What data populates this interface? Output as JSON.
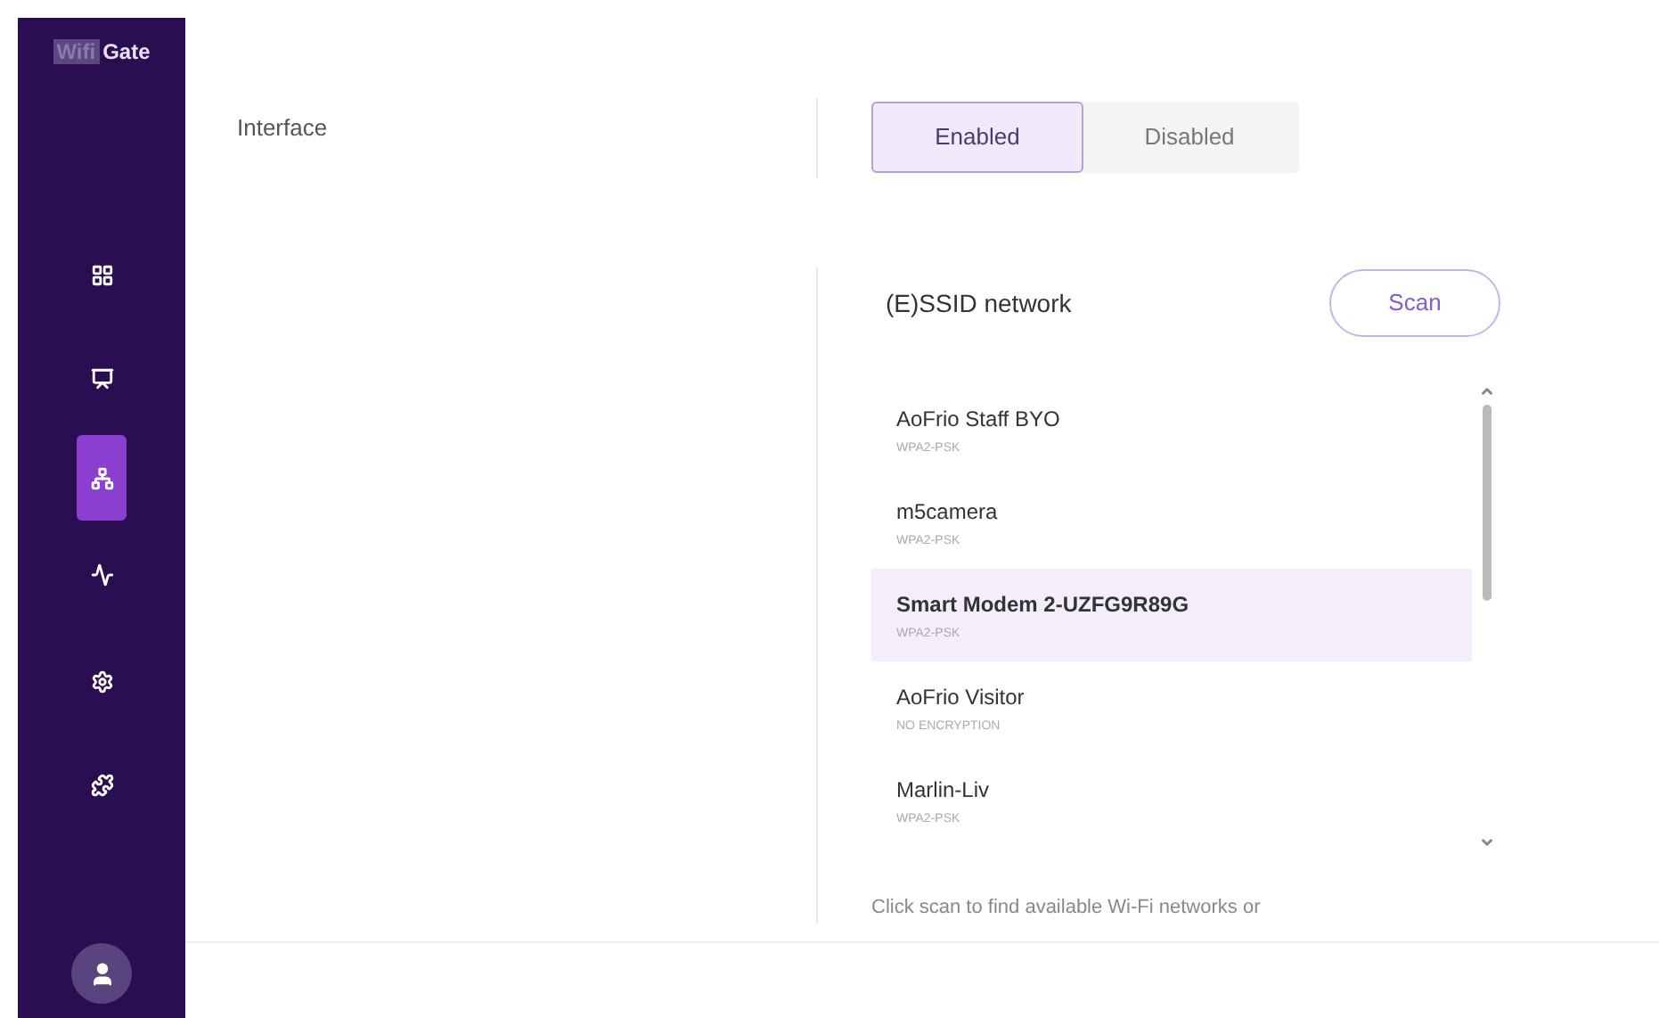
{
  "sidebar": {
    "logo": {
      "boxed": "Wifi",
      "text": "Gate"
    },
    "items": [
      {
        "kind": "dashboard",
        "selected": false
      },
      {
        "kind": "display",
        "selected": false
      },
      {
        "kind": "network",
        "selected": true
      },
      {
        "kind": "activity",
        "selected": false
      },
      {
        "kind": "settings",
        "selected": false
      },
      {
        "kind": "plugins",
        "selected": false
      }
    ]
  },
  "interface": {
    "label": "Interface",
    "options": [
      {
        "label": "Enabled",
        "selected": true
      },
      {
        "label": "Disabled",
        "selected": false
      }
    ]
  },
  "essid": {
    "title": "(E)SSID network",
    "scan_button": "Scan",
    "networks": [
      {
        "name": "AoFrio Staff BYO",
        "security": "WPA2-PSK",
        "selected": false
      },
      {
        "name": "m5camera",
        "security": "WPA2-PSK",
        "selected": false
      },
      {
        "name": "Smart Modem 2-UZFG9R89G",
        "security": "WPA2-PSK",
        "selected": true
      },
      {
        "name": "AoFrio Visitor",
        "security": "NO ENCRYPTION",
        "selected": false
      },
      {
        "name": "Marlin-Liv",
        "security": "WPA2-PSK",
        "selected": false
      }
    ],
    "help": "Click scan to find available Wi-Fi networks or"
  }
}
